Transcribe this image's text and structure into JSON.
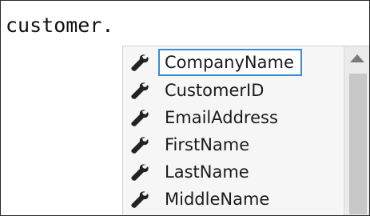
{
  "editor": {
    "text": "customer."
  },
  "intellisense": {
    "items": [
      {
        "label": "CompanyName",
        "icon": "wrench-icon",
        "selected": true
      },
      {
        "label": "CustomerID",
        "icon": "wrench-icon",
        "selected": false
      },
      {
        "label": "EmailAddress",
        "icon": "wrench-icon",
        "selected": false
      },
      {
        "label": "FirstName",
        "icon": "wrench-icon",
        "selected": false
      },
      {
        "label": "LastName",
        "icon": "wrench-icon",
        "selected": false
      },
      {
        "label": "MiddleName",
        "icon": "wrench-icon",
        "selected": false
      }
    ],
    "scrollbar": {
      "up_icon": "scroll-up-arrow-icon"
    }
  },
  "colors": {
    "selection_border": "#3a8bd6",
    "icon": "#222222",
    "popup_background": "#f6f6f6"
  }
}
